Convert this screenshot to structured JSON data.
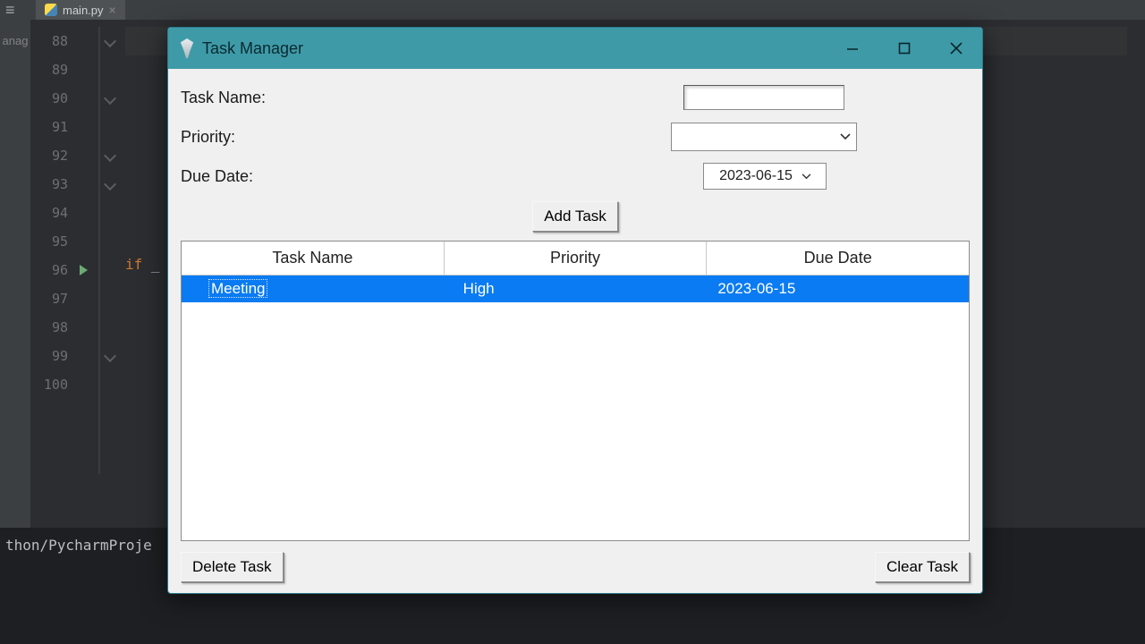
{
  "ide": {
    "tab_name": "main.py",
    "side_label": "anag",
    "line_numbers": [
      "88",
      "89",
      "90",
      "91",
      "92",
      "93",
      "94",
      "95",
      "96",
      "97",
      "98",
      "99",
      "100"
    ],
    "code_if": "if",
    "code_suffix": " _",
    "terminal_text": "thon/PycharmProje"
  },
  "window": {
    "title": "Task Manager"
  },
  "form": {
    "task_name_label": "Task Name:",
    "task_name_value": "",
    "priority_label": "Priority:",
    "priority_value": "",
    "due_date_label": "Due Date:",
    "due_date_value": "2023-06-15",
    "add_button": "Add Task"
  },
  "grid": {
    "columns": [
      "Task Name",
      "Priority",
      "Due Date"
    ],
    "rows": [
      {
        "task": "Meeting",
        "priority": "High",
        "due": "2023-06-15",
        "selected": true
      }
    ]
  },
  "buttons": {
    "delete": "Delete Task",
    "clear": "Clear Task"
  }
}
